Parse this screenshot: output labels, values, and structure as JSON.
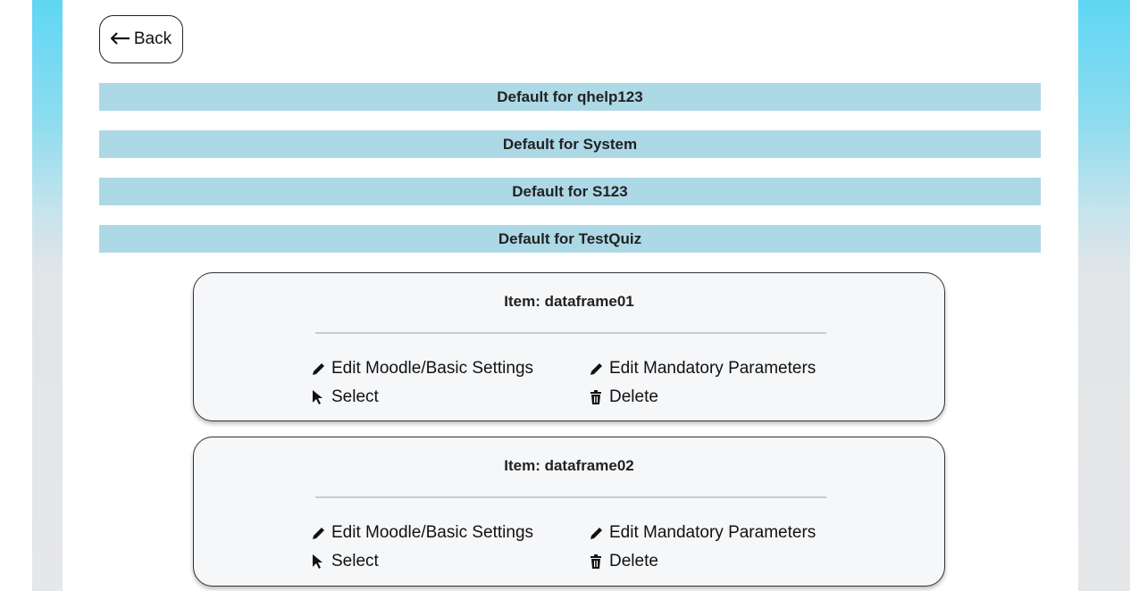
{
  "back_button": {
    "label": "Back"
  },
  "categories": [
    {
      "label": "Default for qhelp123"
    },
    {
      "label": "Default for System"
    },
    {
      "label": "Default for S123"
    },
    {
      "label": "Default for TestQuiz"
    }
  ],
  "items": [
    {
      "title": "Item: dataframe01",
      "actions": {
        "edit_basic": "Edit Moodle/Basic Settings",
        "edit_mandatory": "Edit Mandatory Parameters",
        "select": "Select",
        "delete": "Delete"
      }
    },
    {
      "title": "Item: dataframe02",
      "actions": {
        "edit_basic": "Edit Moodle/Basic Settings",
        "edit_mandatory": "Edit Mandatory Parameters",
        "select": "Select",
        "delete": "Delete"
      }
    }
  ],
  "icons": {
    "back": "arrow-left-icon",
    "edit": "pencil-icon",
    "select": "mouse-pointer-icon",
    "delete": "trash-icon"
  },
  "colors": {
    "category_bar": "#add8e6",
    "card_background": "#f6f7f9",
    "accent_gradient_top": "#5fd6f3"
  }
}
